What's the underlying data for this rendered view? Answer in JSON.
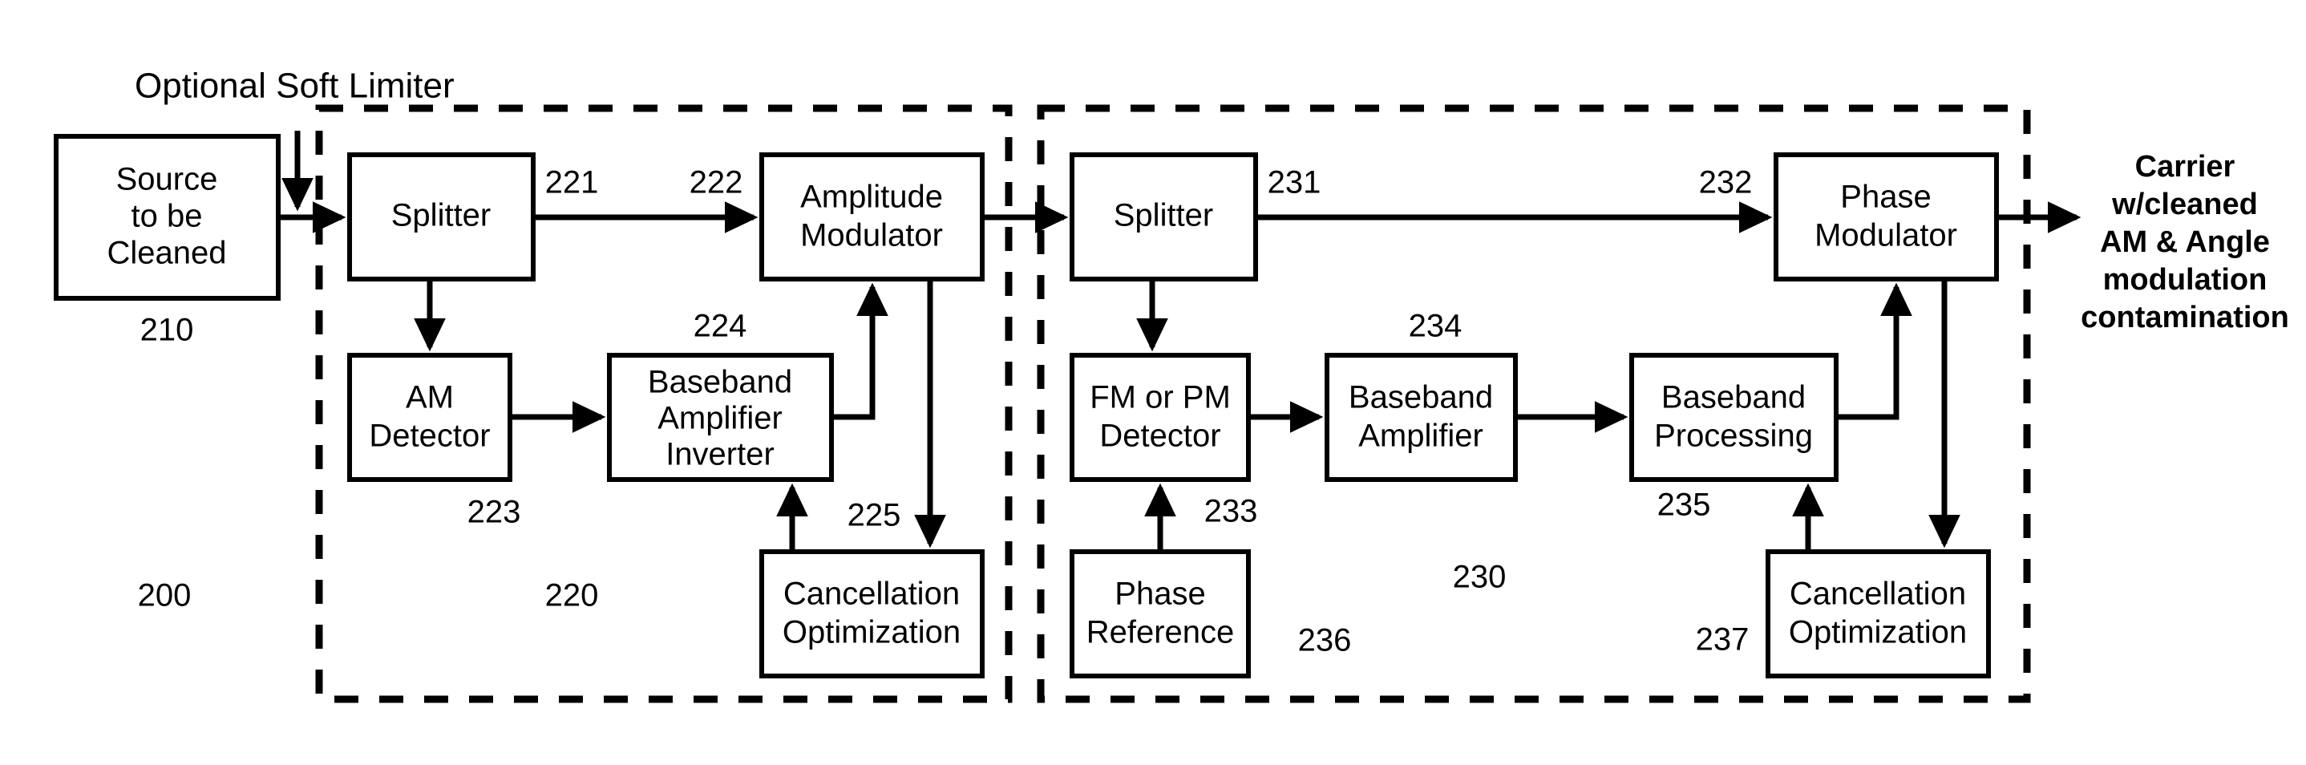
{
  "diagram": {
    "title_annotation": "Optional Soft Limiter",
    "output_annotation_lines": [
      "Carrier",
      "w/cleaned",
      "AM & Angle",
      "modulation",
      "contamination"
    ],
    "blocks": [
      {
        "id": "source",
        "lines": [
          "Source",
          "to be",
          "Cleaned"
        ]
      },
      {
        "id": "splitter_am",
        "lines": [
          "Splitter"
        ]
      },
      {
        "id": "amp_mod",
        "lines": [
          "Amplitude",
          "Modulator"
        ]
      },
      {
        "id": "am_detector",
        "lines": [
          "AM",
          "Detector"
        ]
      },
      {
        "id": "bb_amp_inv",
        "lines": [
          "Baseband",
          "Amplifier",
          "Inverter"
        ]
      },
      {
        "id": "cancel_opt_am",
        "lines": [
          "Cancellation",
          "Optimization"
        ]
      },
      {
        "id": "splitter_pm",
        "lines": [
          "Splitter"
        ]
      },
      {
        "id": "phase_mod",
        "lines": [
          "Phase",
          "Modulator"
        ]
      },
      {
        "id": "fm_pm_det",
        "lines": [
          "FM or PM",
          "Detector"
        ]
      },
      {
        "id": "bb_amp",
        "lines": [
          "Baseband",
          "Amplifier"
        ]
      },
      {
        "id": "bb_proc",
        "lines": [
          "Baseband",
          "Processing"
        ]
      },
      {
        "id": "phase_ref",
        "lines": [
          "Phase",
          "Reference"
        ]
      },
      {
        "id": "cancel_opt_pm",
        "lines": [
          "Cancellation",
          "Optimization"
        ]
      }
    ],
    "reference_numerals": [
      {
        "id": "n200",
        "value": "200"
      },
      {
        "id": "n210",
        "value": "210"
      },
      {
        "id": "n220",
        "value": "220"
      },
      {
        "id": "n221",
        "value": "221"
      },
      {
        "id": "n222",
        "value": "222"
      },
      {
        "id": "n223",
        "value": "223"
      },
      {
        "id": "n224",
        "value": "224"
      },
      {
        "id": "n225",
        "value": "225"
      },
      {
        "id": "n230",
        "value": "230"
      },
      {
        "id": "n231",
        "value": "231"
      },
      {
        "id": "n232",
        "value": "232"
      },
      {
        "id": "n233",
        "value": "233"
      },
      {
        "id": "n234",
        "value": "234"
      },
      {
        "id": "n235",
        "value": "235"
      },
      {
        "id": "n236",
        "value": "236"
      },
      {
        "id": "n237",
        "value": "237"
      }
    ],
    "colors": {
      "stroke": "#000000",
      "fill": "#ffffff",
      "background": "#ffffff"
    }
  }
}
